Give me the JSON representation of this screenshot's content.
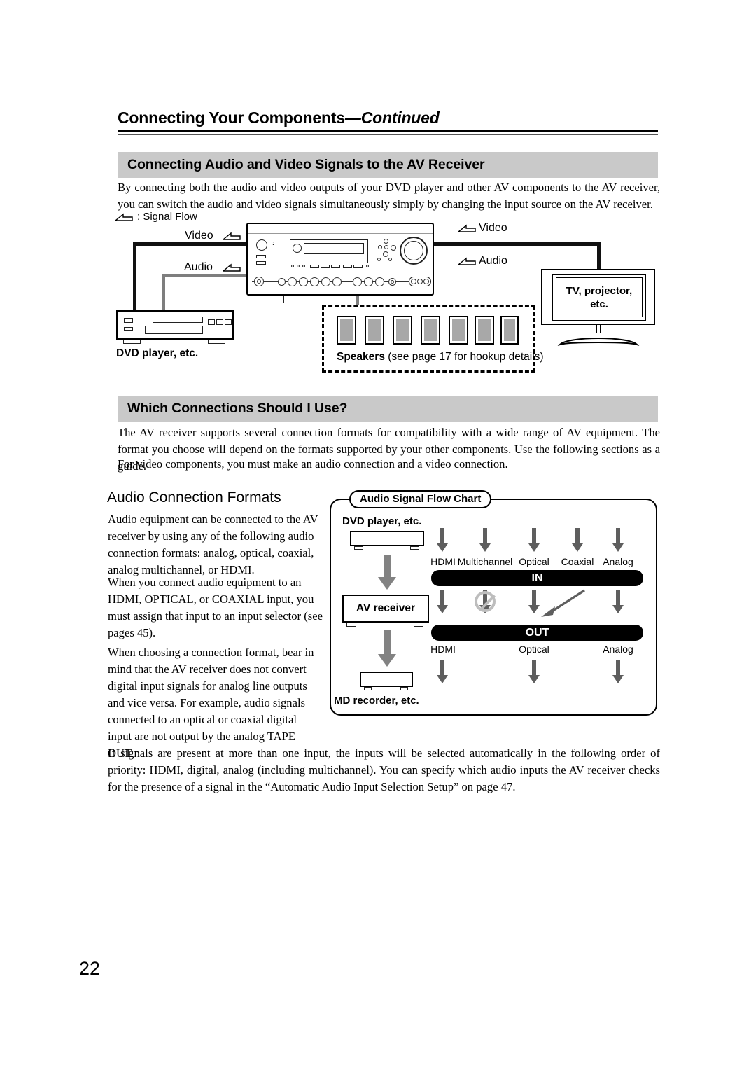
{
  "page": {
    "number": "22",
    "running_head": {
      "main": "Connecting Your Components",
      "continued": "—Continued"
    }
  },
  "sections": [
    {
      "id": "connecting-av",
      "heading": "Connecting Audio and Video Signals to the AV Receiver",
      "body": "By connecting both the audio and video outputs of your DVD player and other AV components to the AV receiver, you can switch the audio and video signals simultaneously simply by changing the input source on the AV receiver."
    },
    {
      "id": "which-connections",
      "heading": "Which Connections Should I Use?",
      "body1": "The AV receiver supports several connection formats for compatibility with a wide range of AV equipment. The format you choose will depend on the formats supported by your other components. Use the following sections as a guide.",
      "body2": "For video components, you must make an audio connection and a video connection."
    }
  ],
  "figure1": {
    "legend": ": Signal Flow",
    "labels": {
      "video_in": "Video",
      "audio_in": "Audio",
      "video_out": "Video",
      "audio_out": "Audio"
    },
    "dvd_caption": "DVD player, etc.",
    "tv_caption_line1": "TV, projector,",
    "tv_caption_line2": "etc.",
    "speakers_bold": "Speakers",
    "speakers_note": " (see page 17 for hookup details)",
    "speaker_count": 7
  },
  "audio_connection_formats": {
    "subhead": "Audio Connection Formats",
    "para1": "Audio equipment can be connected to the AV receiver by using any of the following audio connection formats: analog, optical, coaxial, analog multichannel, or HDMI.",
    "para2": "When you connect audio equipment to an HDMI, OPTICAL, or COAXIAL input, you must assign that input to an input selector (see pages 45).",
    "para3": "When choosing a connection format, bear in mind that the AV receiver does not convert digital input signals for analog line outputs and vice versa. For example, audio signals connected to an optical or coaxial digital input are not output by the analog TAPE OUT."
  },
  "chart_data": {
    "type": "diagram",
    "title": "Audio Signal Flow Chart",
    "nodes": [
      {
        "id": "source",
        "label": "DVD player, etc."
      },
      {
        "id": "receiver",
        "label": "AV receiver"
      },
      {
        "id": "recorder",
        "label": "MD recorder, etc."
      }
    ],
    "bars": [
      {
        "id": "in",
        "label": "IN"
      },
      {
        "id": "out",
        "label": "OUT"
      }
    ],
    "inputs": [
      "HDMI",
      "Multichannel",
      "Optical",
      "Coaxial",
      "Analog"
    ],
    "outputs": [
      "HDMI",
      "Optical",
      "Analog"
    ],
    "blocked_path": "Multichannel",
    "crossover_note": "Coaxial routed to Optical OUT",
    "legend_position": "top"
  },
  "closing_paragraph": "If signals are present at more than one input, the inputs will be selected automatically in the following order of priority: HDMI, digital, analog (including multichannel). You can specify which audio inputs the AV receiver checks for the presence of a signal in the “Automatic Audio Input Selection Setup” on page 47."
}
